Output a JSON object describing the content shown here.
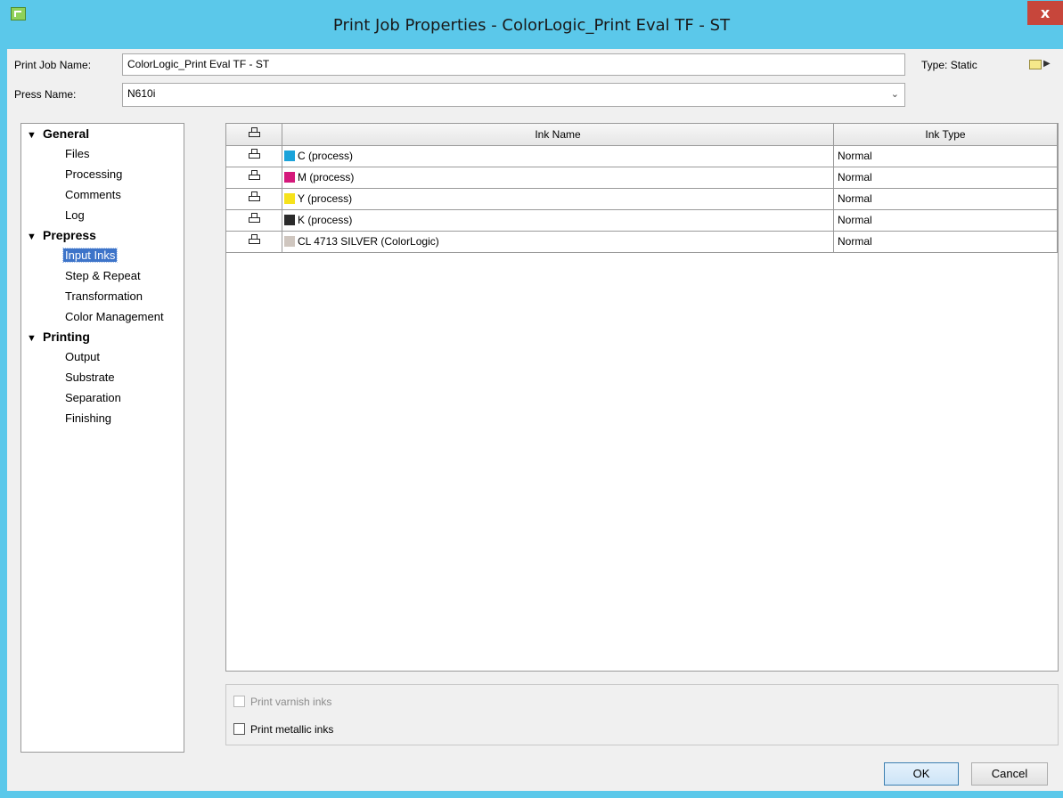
{
  "window": {
    "title": "Print Job Properties - ColorLogic_Print Eval TF - ST",
    "close_label": "x"
  },
  "header": {
    "job_name_label": "Print Job Name:",
    "job_name_value": "ColorLogic_Print Eval TF - ST",
    "type_label": "Type:",
    "type_value": "Static",
    "press_name_label": "Press Name:",
    "press_name_value": "N610i"
  },
  "tree": {
    "categories": [
      {
        "label": "General",
        "items": [
          "Files",
          "Processing",
          "Comments",
          "Log"
        ]
      },
      {
        "label": "Prepress",
        "items": [
          "Input Inks",
          "Step & Repeat",
          "Transformation",
          "Color Management"
        ]
      },
      {
        "label": "Printing",
        "items": [
          "Output",
          "Substrate",
          "Separation",
          "Finishing"
        ]
      }
    ],
    "selected": "Input Inks"
  },
  "ink_table": {
    "columns": {
      "print_icon": "printer-icon",
      "name": "Ink Name",
      "type": "Ink Type"
    },
    "rows": [
      {
        "name": "C (process)",
        "type": "Normal",
        "color": "#1ba3da"
      },
      {
        "name": "M (process)",
        "type": "Normal",
        "color": "#d4197b"
      },
      {
        "name": "Y (process)",
        "type": "Normal",
        "color": "#f6e21c"
      },
      {
        "name": "K (process)",
        "type": "Normal",
        "color": "#2b2b2b"
      },
      {
        "name": "CL 4713 SILVER (ColorLogic)",
        "type": "Normal",
        "color": "#cfc6bf"
      }
    ]
  },
  "options": {
    "varnish_label": "Print varnish inks",
    "metallic_label": "Print metallic inks"
  },
  "buttons": {
    "ok": "OK",
    "cancel": "Cancel"
  },
  "colors": {
    "titlebar": "#5bc8ea",
    "selection": "#3d74c9",
    "close": "#c7463b"
  }
}
